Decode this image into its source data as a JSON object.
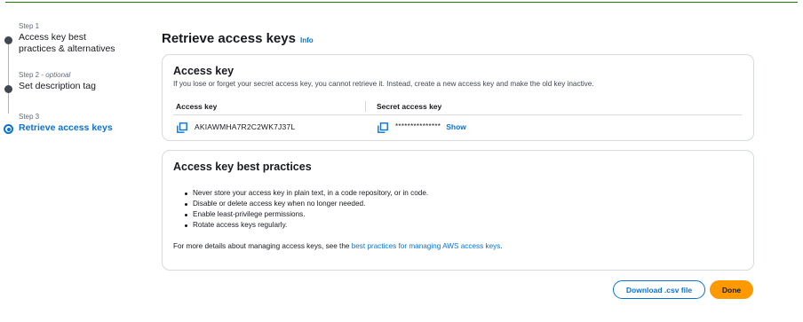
{
  "stepper": {
    "steps": [
      {
        "num": "Step 1",
        "optional": "",
        "title": "Access key best practices & alternatives",
        "state": "done"
      },
      {
        "num": "Step 2",
        "optional": "optional",
        "title": "Set description tag",
        "state": "done"
      },
      {
        "num": "Step 3",
        "optional": "",
        "title": "Retrieve access keys",
        "state": "active"
      }
    ]
  },
  "header": {
    "title": "Retrieve access keys",
    "info": "Info"
  },
  "keys_panel": {
    "title": "Access key",
    "description": "If you lose or forget your secret access key, you cannot retrieve it. Instead, create a new access key and make the old key inactive.",
    "col_access_key": "Access key",
    "col_secret_key": "Secret access key",
    "access_key_value": "AKIAWMHA7R2C2WK7J37L",
    "secret_masked": "***************",
    "show_label": "Show"
  },
  "best_practices": {
    "title": "Access key best practices",
    "items": [
      "Never store your access key in plain text, in a code repository, or in code.",
      "Disable or delete access key when no longer needed.",
      "Enable least-privilege permissions.",
      "Rotate access keys regularly."
    ],
    "footer_prefix": "For more details about managing access keys, see the ",
    "footer_link": "best practices for managing AWS access keys",
    "footer_suffix": "."
  },
  "actions": {
    "download": "Download .csv file",
    "done": "Done"
  },
  "colors": {
    "accent": "#0972d3",
    "primary_button": "#ff9900",
    "success_line": "#1d8102"
  },
  "icons": {
    "copy": "copy-icon"
  }
}
